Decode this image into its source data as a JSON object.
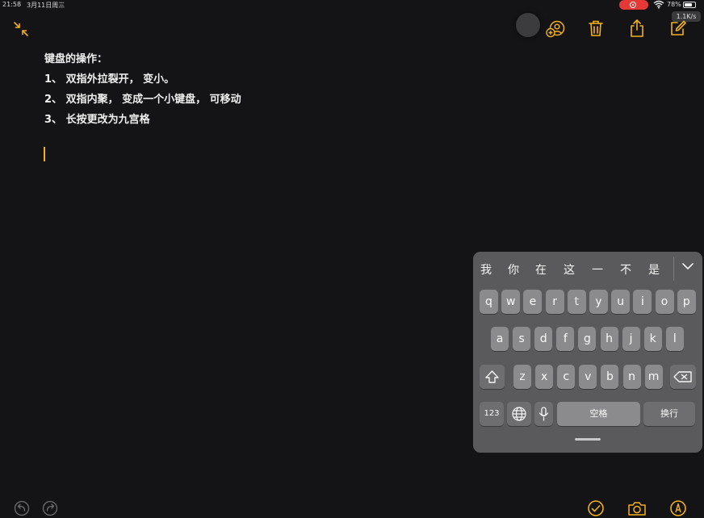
{
  "status_bar": {
    "time": "21:58",
    "date": "3月11日周三",
    "battery_percent": "78%",
    "battery_level": 0.78,
    "net_speed": "1.1K/s"
  },
  "toolbar": {
    "icons": [
      "collapse-icon",
      "add-person-icon",
      "trash-icon",
      "share-icon",
      "compose-icon"
    ],
    "accent_color": "#f2b11c"
  },
  "note": {
    "lines": [
      "键盘的操作：",
      "1、 双指外拉裂开， 变小。",
      "2、 双指内聚， 变成一个小键盘， 可移动",
      "3、 长按更改为九宫格"
    ]
  },
  "keyboard": {
    "candidates": [
      "我",
      "你",
      "在",
      "这",
      "一",
      "不",
      "是"
    ],
    "row1": [
      "q",
      "w",
      "e",
      "r",
      "t",
      "y",
      "u",
      "i",
      "o",
      "p"
    ],
    "row2": [
      "a",
      "s",
      "d",
      "f",
      "g",
      "h",
      "j",
      "k",
      "l"
    ],
    "row3": [
      "z",
      "x",
      "c",
      "v",
      "b",
      "n",
      "m"
    ],
    "numbers_label": "123",
    "space_label": "空格",
    "return_label": "换行"
  },
  "bottom_bar": {
    "icons": [
      "undo-icon",
      "redo-icon",
      "checklist-icon",
      "camera-icon",
      "markup-icon"
    ]
  }
}
